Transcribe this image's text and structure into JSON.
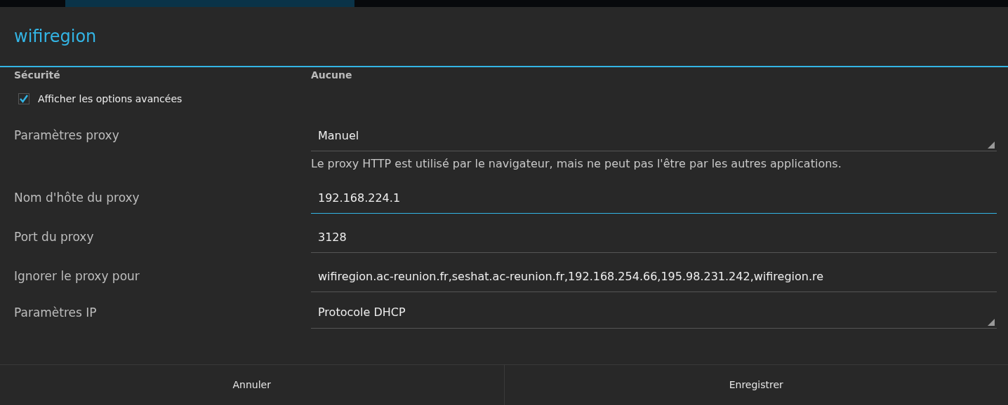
{
  "dialog": {
    "title": "wifiregion"
  },
  "security": {
    "label": "Sécurité",
    "value": "Aucune"
  },
  "advanced_checkbox": {
    "label": "Afficher les options avancées",
    "checked": true
  },
  "rows": [
    {
      "kind": "spinner",
      "label": "Paramètres proxy",
      "value": "Manuel"
    },
    {
      "kind": "hint",
      "text": "Le proxy HTTP est utilisé par le navigateur, mais ne peut pas l'être par les autres applications."
    },
    {
      "kind": "input",
      "label": "Nom d'hôte du proxy",
      "value": "192.168.224.1",
      "focused": true
    },
    {
      "kind": "input",
      "label": "Port du proxy",
      "value": "3128",
      "focused": false
    },
    {
      "kind": "input",
      "label": "Ignorer le proxy pour",
      "value": "wifiregion.ac-reunion.fr,seshat.ac-reunion.fr,192.168.254.66,195.98.231.242,wifiregion.re",
      "focused": false
    },
    {
      "kind": "spinner",
      "label": "Paramètres IP",
      "value": "Protocole DHCP"
    }
  ],
  "buttons": [
    "Annuler",
    "Enregistrer"
  ]
}
